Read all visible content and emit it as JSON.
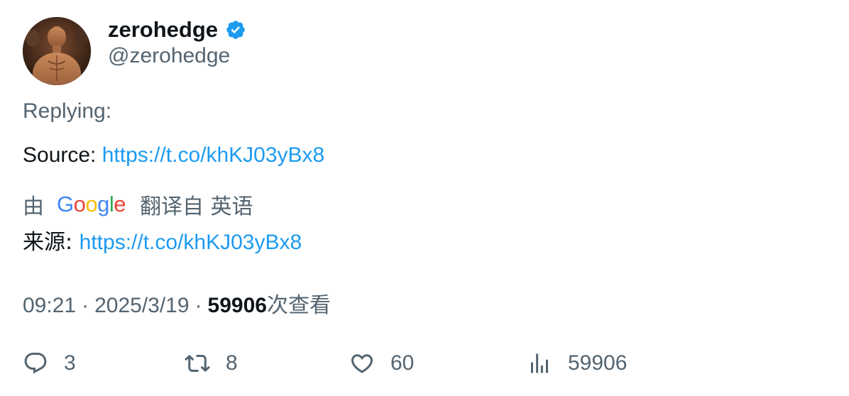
{
  "author": {
    "display_name": "zerohedge",
    "handle": "@zerohedge",
    "verified": true,
    "verified_color": "#1d9bf0"
  },
  "tweet": {
    "replying_label": "Replying:",
    "source_label": "Source: ",
    "source_link": "https://t.co/khKJ03yBx8"
  },
  "translation": {
    "by_label": "由",
    "provider": "Google",
    "translated_from_label": "翻译自 英语",
    "source_label": "来源: ",
    "source_link": "https://t.co/khKJ03yBx8"
  },
  "meta": {
    "time": "09:21",
    "separator": "·",
    "date": "2025/3/19",
    "views_count": "59906",
    "views_label": "次查看"
  },
  "actions": {
    "replies": "3",
    "retweets": "8",
    "likes": "60",
    "views": "59906"
  },
  "colors": {
    "text_primary": "#0f1419",
    "text_secondary": "#536471",
    "link": "#1d9bf0"
  }
}
